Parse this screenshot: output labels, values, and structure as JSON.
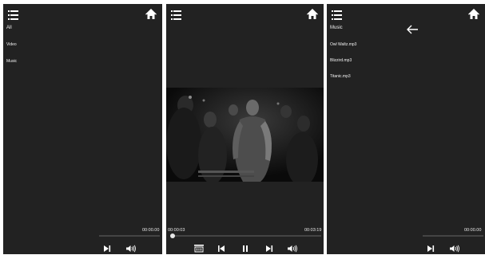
{
  "panel_library": {
    "items": [
      "All",
      "Video",
      "Music"
    ],
    "player": {
      "time": "00:00.00",
      "progress": 0
    }
  },
  "panel_player": {
    "current_time": "00:00:03",
    "total_time": "00:03:19",
    "progress": 0.02
  },
  "panel_music": {
    "title": "Music",
    "tracks": [
      "Owl Waltz.mp3",
      "Blizzird.mp3",
      "Titanic.mp3"
    ],
    "player": {
      "time": "00:00.00",
      "progress": 0
    }
  },
  "icons": {
    "menu": "hamburger-icon",
    "home": "home-icon",
    "back": "back-arrow-icon",
    "next": "skip-next-icon",
    "previous": "skip-previous-icon",
    "pause": "pause-icon",
    "volume": "volume-icon",
    "playlist": "playlist-icon"
  },
  "colors": {
    "panel_bg": "#222222",
    "text": "#f2f2f2",
    "track": "#444444",
    "knob": "#e6e6e6"
  }
}
